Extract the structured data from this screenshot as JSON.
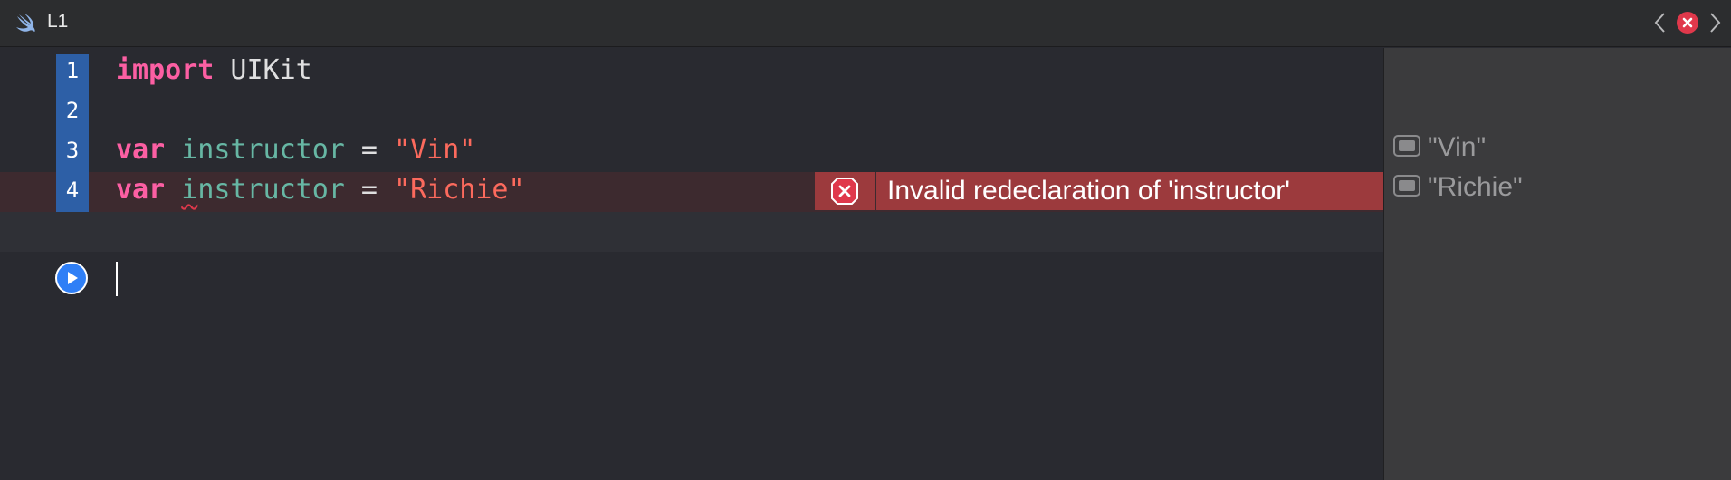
{
  "titlebar": {
    "title": "L1",
    "icon": "swift-icon"
  },
  "editor": {
    "lines": [
      {
        "number": "1"
      },
      {
        "number": "2"
      },
      {
        "number": "3"
      },
      {
        "number": "4"
      }
    ],
    "line1": {
      "kw": "import",
      "rest": " UIKit"
    },
    "line3": {
      "kw": "var",
      "ident": "instructor",
      "eq": " = ",
      "str": "\"Vin\""
    },
    "line4": {
      "kw": "var",
      "ident_first": "i",
      "ident_rest": "nstructor",
      "eq": " = ",
      "str": "\"Richie\""
    },
    "error": {
      "message": "Invalid redeclaration of 'instructor'"
    }
  },
  "results": [
    {
      "value": "\"Vin\""
    },
    {
      "value": "\"Richie\""
    }
  ],
  "colors": {
    "keyword": "#fc5fa3",
    "identifier": "#67b7a4",
    "string": "#fc6a5d",
    "error": "#9c3a3d",
    "gutter": "#2d5fa6"
  }
}
